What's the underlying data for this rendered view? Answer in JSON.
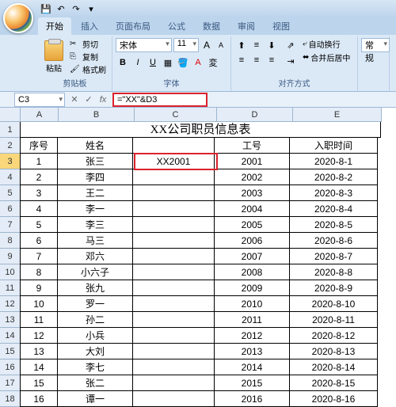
{
  "qat": {
    "save": "💾",
    "undo": "↶",
    "redo": "↷",
    "dd": "▾"
  },
  "tabs": [
    "开始",
    "插入",
    "页面布局",
    "公式",
    "数据",
    "审阅",
    "视图"
  ],
  "active_tab": 0,
  "ribbon": {
    "clipboard": {
      "label": "剪贴板",
      "paste": "粘贴",
      "cut": "剪切",
      "copy": "复制",
      "format": "格式刷"
    },
    "font": {
      "label": "字体",
      "name": "宋体",
      "size": "11",
      "grow": "A",
      "shrink": "A",
      "b": "B",
      "i": "I",
      "u": "U"
    },
    "align": {
      "label": "对齐方式",
      "wrap": "自动换行",
      "merge": "合并后居中"
    },
    "number": {
      "label": "常规"
    }
  },
  "namebox": "C3",
  "formula": "=\"XX\"&D3",
  "columns": [
    "A",
    "B",
    "C",
    "D",
    "E"
  ],
  "title_text": "XX公司职员信息表",
  "headers": {
    "a": "序号",
    "b": "姓名",
    "c": "",
    "d": "工号",
    "e": "入职时间"
  },
  "active_value": "XX2001",
  "rows": [
    {
      "n": "1",
      "name": "张三",
      "id": "2001",
      "date": "2020-8-1"
    },
    {
      "n": "2",
      "name": "李四",
      "id": "2002",
      "date": "2020-8-2"
    },
    {
      "n": "3",
      "name": "王二",
      "id": "2003",
      "date": "2020-8-3"
    },
    {
      "n": "4",
      "name": "李一",
      "id": "2004",
      "date": "2020-8-4"
    },
    {
      "n": "5",
      "name": "李三",
      "id": "2005",
      "date": "2020-8-5"
    },
    {
      "n": "6",
      "name": "马三",
      "id": "2006",
      "date": "2020-8-6"
    },
    {
      "n": "7",
      "name": "邓六",
      "id": "2007",
      "date": "2020-8-7"
    },
    {
      "n": "8",
      "name": "小六子",
      "id": "2008",
      "date": "2020-8-8"
    },
    {
      "n": "9",
      "name": "张九",
      "id": "2009",
      "date": "2020-8-9"
    },
    {
      "n": "10",
      "name": "罗一",
      "id": "2010",
      "date": "2020-8-10"
    },
    {
      "n": "11",
      "name": "孙二",
      "id": "2011",
      "date": "2020-8-11"
    },
    {
      "n": "12",
      "name": "小兵",
      "id": "2012",
      "date": "2020-8-12"
    },
    {
      "n": "13",
      "name": "大刘",
      "id": "2013",
      "date": "2020-8-13"
    },
    {
      "n": "14",
      "name": "李七",
      "id": "2014",
      "date": "2020-8-14"
    },
    {
      "n": "15",
      "name": "张二",
      "id": "2015",
      "date": "2020-8-15"
    },
    {
      "n": "16",
      "name": "谭一",
      "id": "2016",
      "date": "2020-8-16"
    }
  ]
}
